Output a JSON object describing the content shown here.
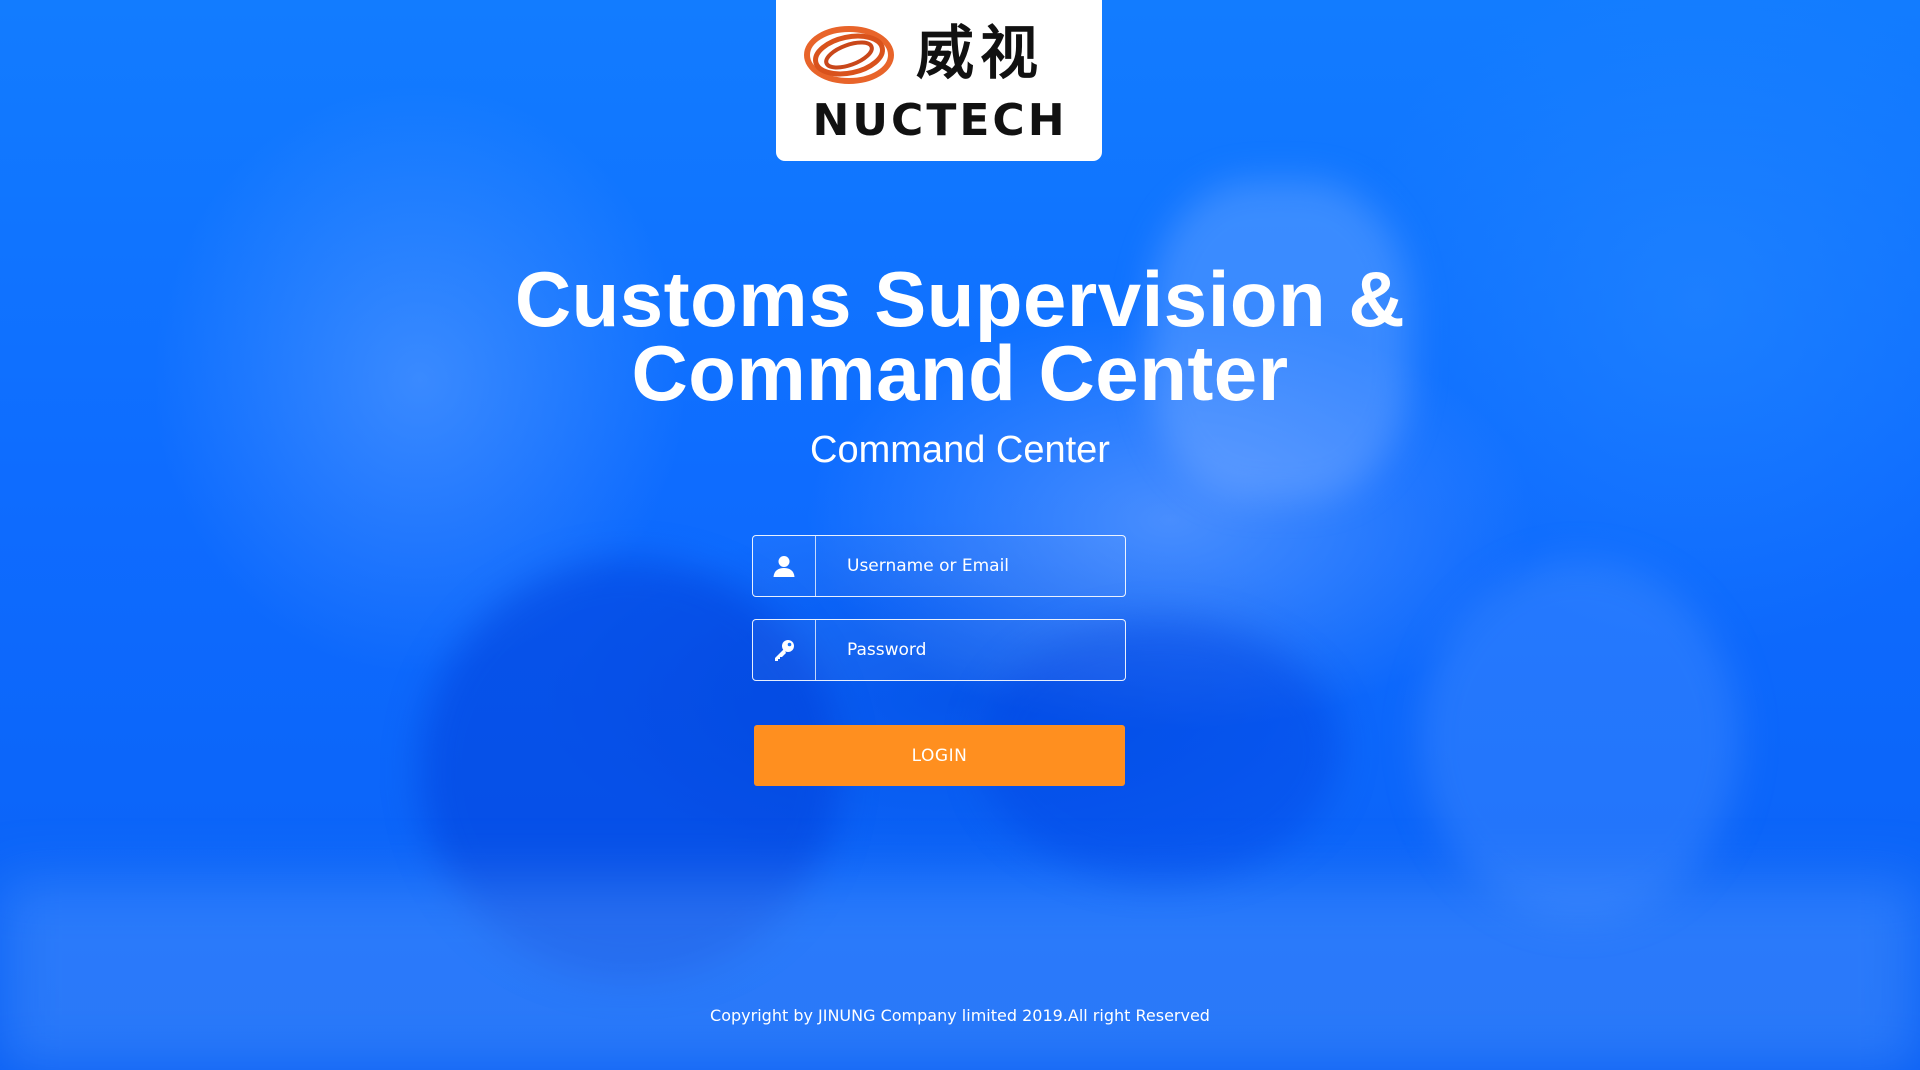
{
  "logo": {
    "chinese_text": "威视",
    "brand_text": "NUCTECH",
    "mark_icon": "orbit-logo-icon",
    "colors": {
      "mark": "#e8642a",
      "text": "#111111",
      "background": "#ffffff"
    }
  },
  "header": {
    "title_line1": "Customs Supervision &",
    "title_line2": "Command Center",
    "subtitle": "Command Center"
  },
  "login_form": {
    "username": {
      "placeholder": "Username or Email",
      "value": "",
      "icon": "user-icon"
    },
    "password": {
      "placeholder": "Password",
      "value": "",
      "icon": "key-icon"
    },
    "submit_label": "LOGIN"
  },
  "footer": {
    "copyright": "Copyright by JINUNG Company limited 2019.All right Reserved"
  },
  "colors": {
    "background": "#1173ff",
    "button": "#ff8f1f",
    "text": "#ffffff"
  }
}
